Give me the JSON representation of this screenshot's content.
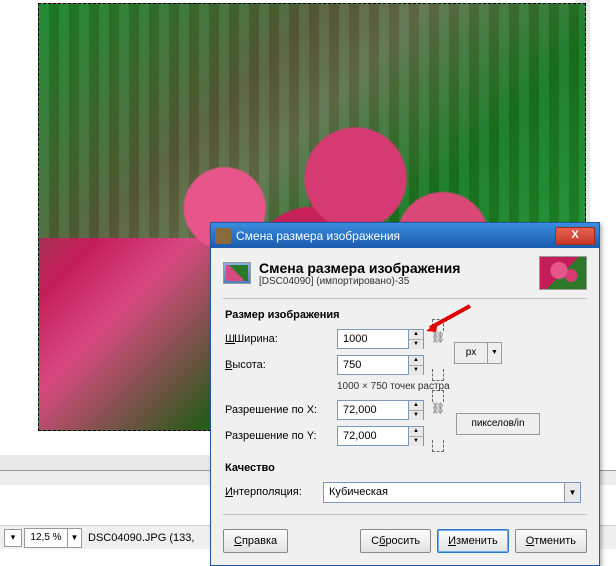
{
  "statusbar": {
    "zoom": "12,5 %",
    "file_info": "DSC04090.JPG (133,"
  },
  "dialog": {
    "title": "Смена размера изображения",
    "close": "X",
    "header_title": "Смена размера изображения",
    "header_sub": "[DSC04090] (импортировано)-35",
    "sec_size_title": "Размер изображения",
    "width_label": "Ширина:",
    "width_u": "Ш",
    "height_label": "ысота:",
    "height_u": "В",
    "width_val": "1000",
    "height_val": "750",
    "raster_hint": "1000 × 750 точек растра",
    "unit_px": "px",
    "resx_label": "Разрешение по X:",
    "resy_label": "Разрешение по Y:",
    "resx_val": "72,000",
    "resy_val": "72,000",
    "unit_ppi": "пикселов/in",
    "sec_quality": "Качество",
    "interp_label": "нтерполяция:",
    "interp_u": "И",
    "interp_val": "Кубическая",
    "buttons": {
      "help": "Справка",
      "help_u": "С",
      "reset": "Сбросить",
      "reset_u": "б",
      "apply": "Изменить",
      "apply_u": "И",
      "cancel": "Отменить",
      "cancel_u": "О",
      "help_rest": "правка",
      "reset_pre": "С",
      "reset_rest": "росить",
      "apply_rest": "зменить",
      "cancel_rest": "тменить"
    }
  }
}
